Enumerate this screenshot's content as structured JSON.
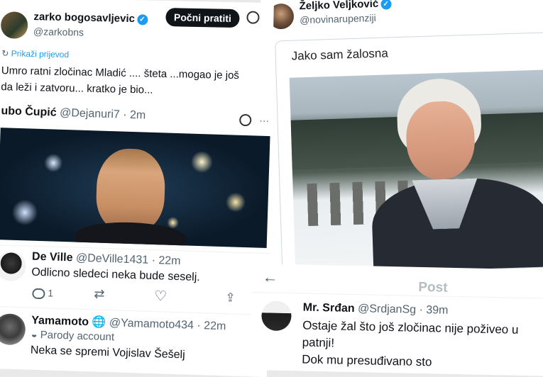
{
  "tweet_zarko": {
    "name": "zarko bogosavljevic",
    "handle": "@zarkobns",
    "follow_label": "Počni pratiti",
    "translate_label": "Prikaži prijevod",
    "text_line1": "Umro ratni zločinac Mladić .... šteta ...mogao je još",
    "text_line2": "da leži i zatvoru... kratko je bio..."
  },
  "tweet_ljubo": {
    "name": "ubo Čupić",
    "handle": "@Dejanuri7",
    "time": "· 2m"
  },
  "reply_deville": {
    "name": "De Ville",
    "handle": "@DeVille1431",
    "time": "· 22m",
    "text": "Odlicno sledeci neka bude seselj.",
    "reply_count": "1"
  },
  "reply_yamamoto": {
    "name": "Yamamoto",
    "handle": "@Yamamoto434",
    "time": "· 22m",
    "parody_label": "Parody account",
    "text": "Neka se spremi Vojislav Šešelj"
  },
  "tweet_zeljko": {
    "name": "Željko Veljković",
    "handle": "@novinarupenziji",
    "quote_text": "Jako sam žalosna"
  },
  "post_srdjan": {
    "header_title": "Post",
    "name": "Mr. Srđan",
    "handle": "@SrdjanSg",
    "time": "· 39m",
    "text_line1": "Ostaje žal što još zločinac nije poživeo u",
    "text_line2": "patnji!",
    "text_line3": "Dok mu presuđivano sto"
  },
  "colors": {
    "accent": "#1d9bf0",
    "text": "#0f1419",
    "muted": "#536471",
    "follow_bg": "#0f1419"
  }
}
